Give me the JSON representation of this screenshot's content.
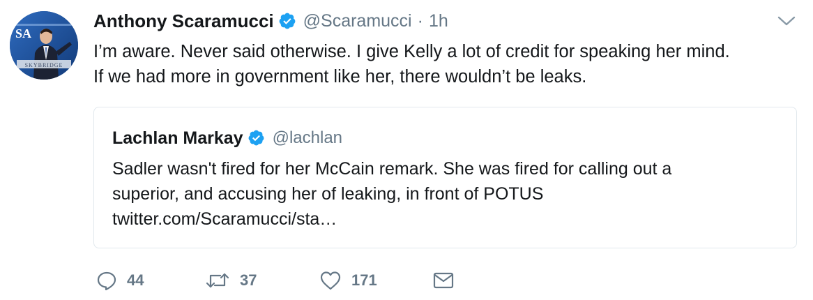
{
  "tweet": {
    "author": {
      "display_name": "Anthony Scaramucci",
      "handle": "@Scaramucci",
      "verified": true,
      "avatar_banner_text": "SKYBRIDGE",
      "avatar_corner_text": "SA"
    },
    "separator": "·",
    "timestamp": "1h",
    "text_lines": [
      "I’m aware. Never said otherwise. I give Kelly a lot of credit for speaking her mind.",
      "If we had more in government like her, there wouldn’t be leaks."
    ],
    "quoted": {
      "display_name": "Lachlan Markay",
      "handle": "@lachlan",
      "verified": true,
      "text_lines": [
        "Sadler wasn't fired for her McCain remark. She was fired for calling out a",
        "superior, and accusing her of leaking, in front of POTUS",
        "twitter.com/Scaramucci/sta…"
      ]
    },
    "actions": {
      "replies": "44",
      "retweets": "37",
      "likes": "171"
    }
  },
  "colors": {
    "text": "#14171a",
    "secondary": "#657786",
    "verified_blue": "#1da1f2",
    "border": "#e1e8ed"
  }
}
